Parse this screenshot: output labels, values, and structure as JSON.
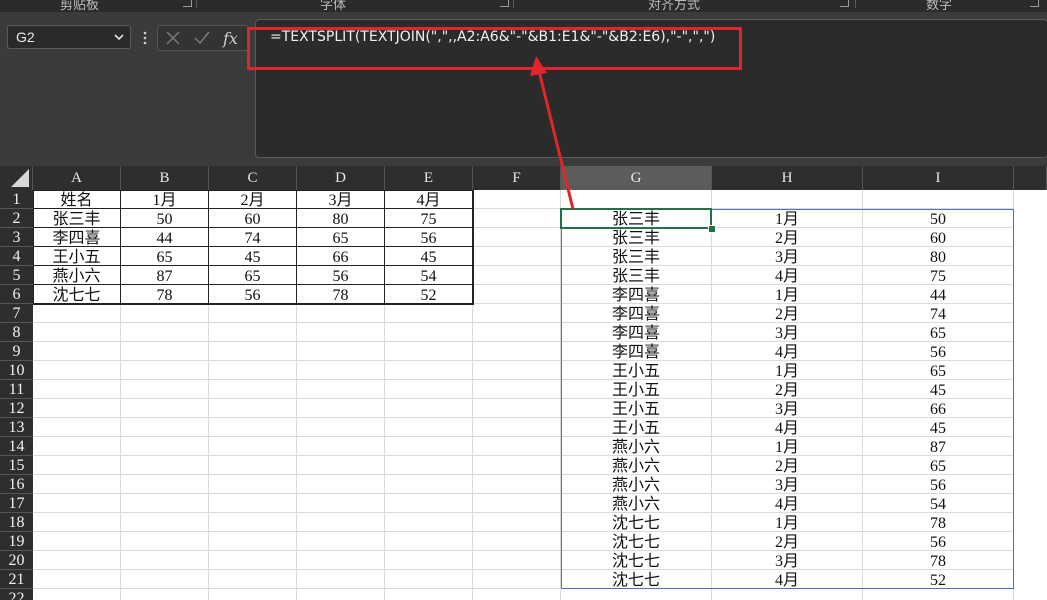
{
  "ribbon": {
    "groups": [
      "剪贴板",
      "字体",
      "对齐方式",
      "数字"
    ]
  },
  "name_box": {
    "value": "G2"
  },
  "formula_bar": {
    "formula": "=TEXTSPLIT(TEXTJOIN(\",\",,A2:A6&\"-\"&B1:E1&\"-\"&B2:E6),\"-\",\",\")"
  },
  "annotation": {
    "color": "#e0262c"
  },
  "grid": {
    "columns": [
      "A",
      "B",
      "C",
      "D",
      "E",
      "F",
      "G",
      "H",
      "I"
    ],
    "rows": [
      "1",
      "2",
      "3",
      "4",
      "5",
      "6",
      "7",
      "8",
      "9",
      "10",
      "11",
      "12",
      "13",
      "14",
      "15",
      "16",
      "17",
      "18",
      "19",
      "20",
      "21",
      "22"
    ],
    "active_column": "G",
    "source_table": [
      [
        "姓名",
        "1月",
        "2月",
        "3月",
        "4月"
      ],
      [
        "张三丰",
        "50",
        "60",
        "80",
        "75"
      ],
      [
        "李四喜",
        "44",
        "74",
        "65",
        "56"
      ],
      [
        "王小五",
        "65",
        "45",
        "66",
        "45"
      ],
      [
        "燕小六",
        "87",
        "65",
        "56",
        "54"
      ],
      [
        "沈七七",
        "78",
        "56",
        "78",
        "52"
      ]
    ],
    "spill_result": [
      [
        "张三丰",
        "1月",
        "50"
      ],
      [
        "张三丰",
        "2月",
        "60"
      ],
      [
        "张三丰",
        "3月",
        "80"
      ],
      [
        "张三丰",
        "4月",
        "75"
      ],
      [
        "李四喜",
        "1月",
        "44"
      ],
      [
        "李四喜",
        "2月",
        "74"
      ],
      [
        "李四喜",
        "3月",
        "65"
      ],
      [
        "李四喜",
        "4月",
        "56"
      ],
      [
        "王小五",
        "1月",
        "65"
      ],
      [
        "王小五",
        "2月",
        "45"
      ],
      [
        "王小五",
        "3月",
        "66"
      ],
      [
        "王小五",
        "4月",
        "45"
      ],
      [
        "燕小六",
        "1月",
        "87"
      ],
      [
        "燕小六",
        "2月",
        "65"
      ],
      [
        "燕小六",
        "3月",
        "56"
      ],
      [
        "燕小六",
        "4月",
        "54"
      ],
      [
        "沈七七",
        "1月",
        "78"
      ],
      [
        "沈七七",
        "2月",
        "56"
      ],
      [
        "沈七七",
        "3月",
        "78"
      ],
      [
        "沈七七",
        "4月",
        "52"
      ]
    ]
  },
  "colors": {
    "active_cell_border": "#217346",
    "spill_border": "#4a73b8",
    "dark_ui": "#2e2e2e"
  }
}
